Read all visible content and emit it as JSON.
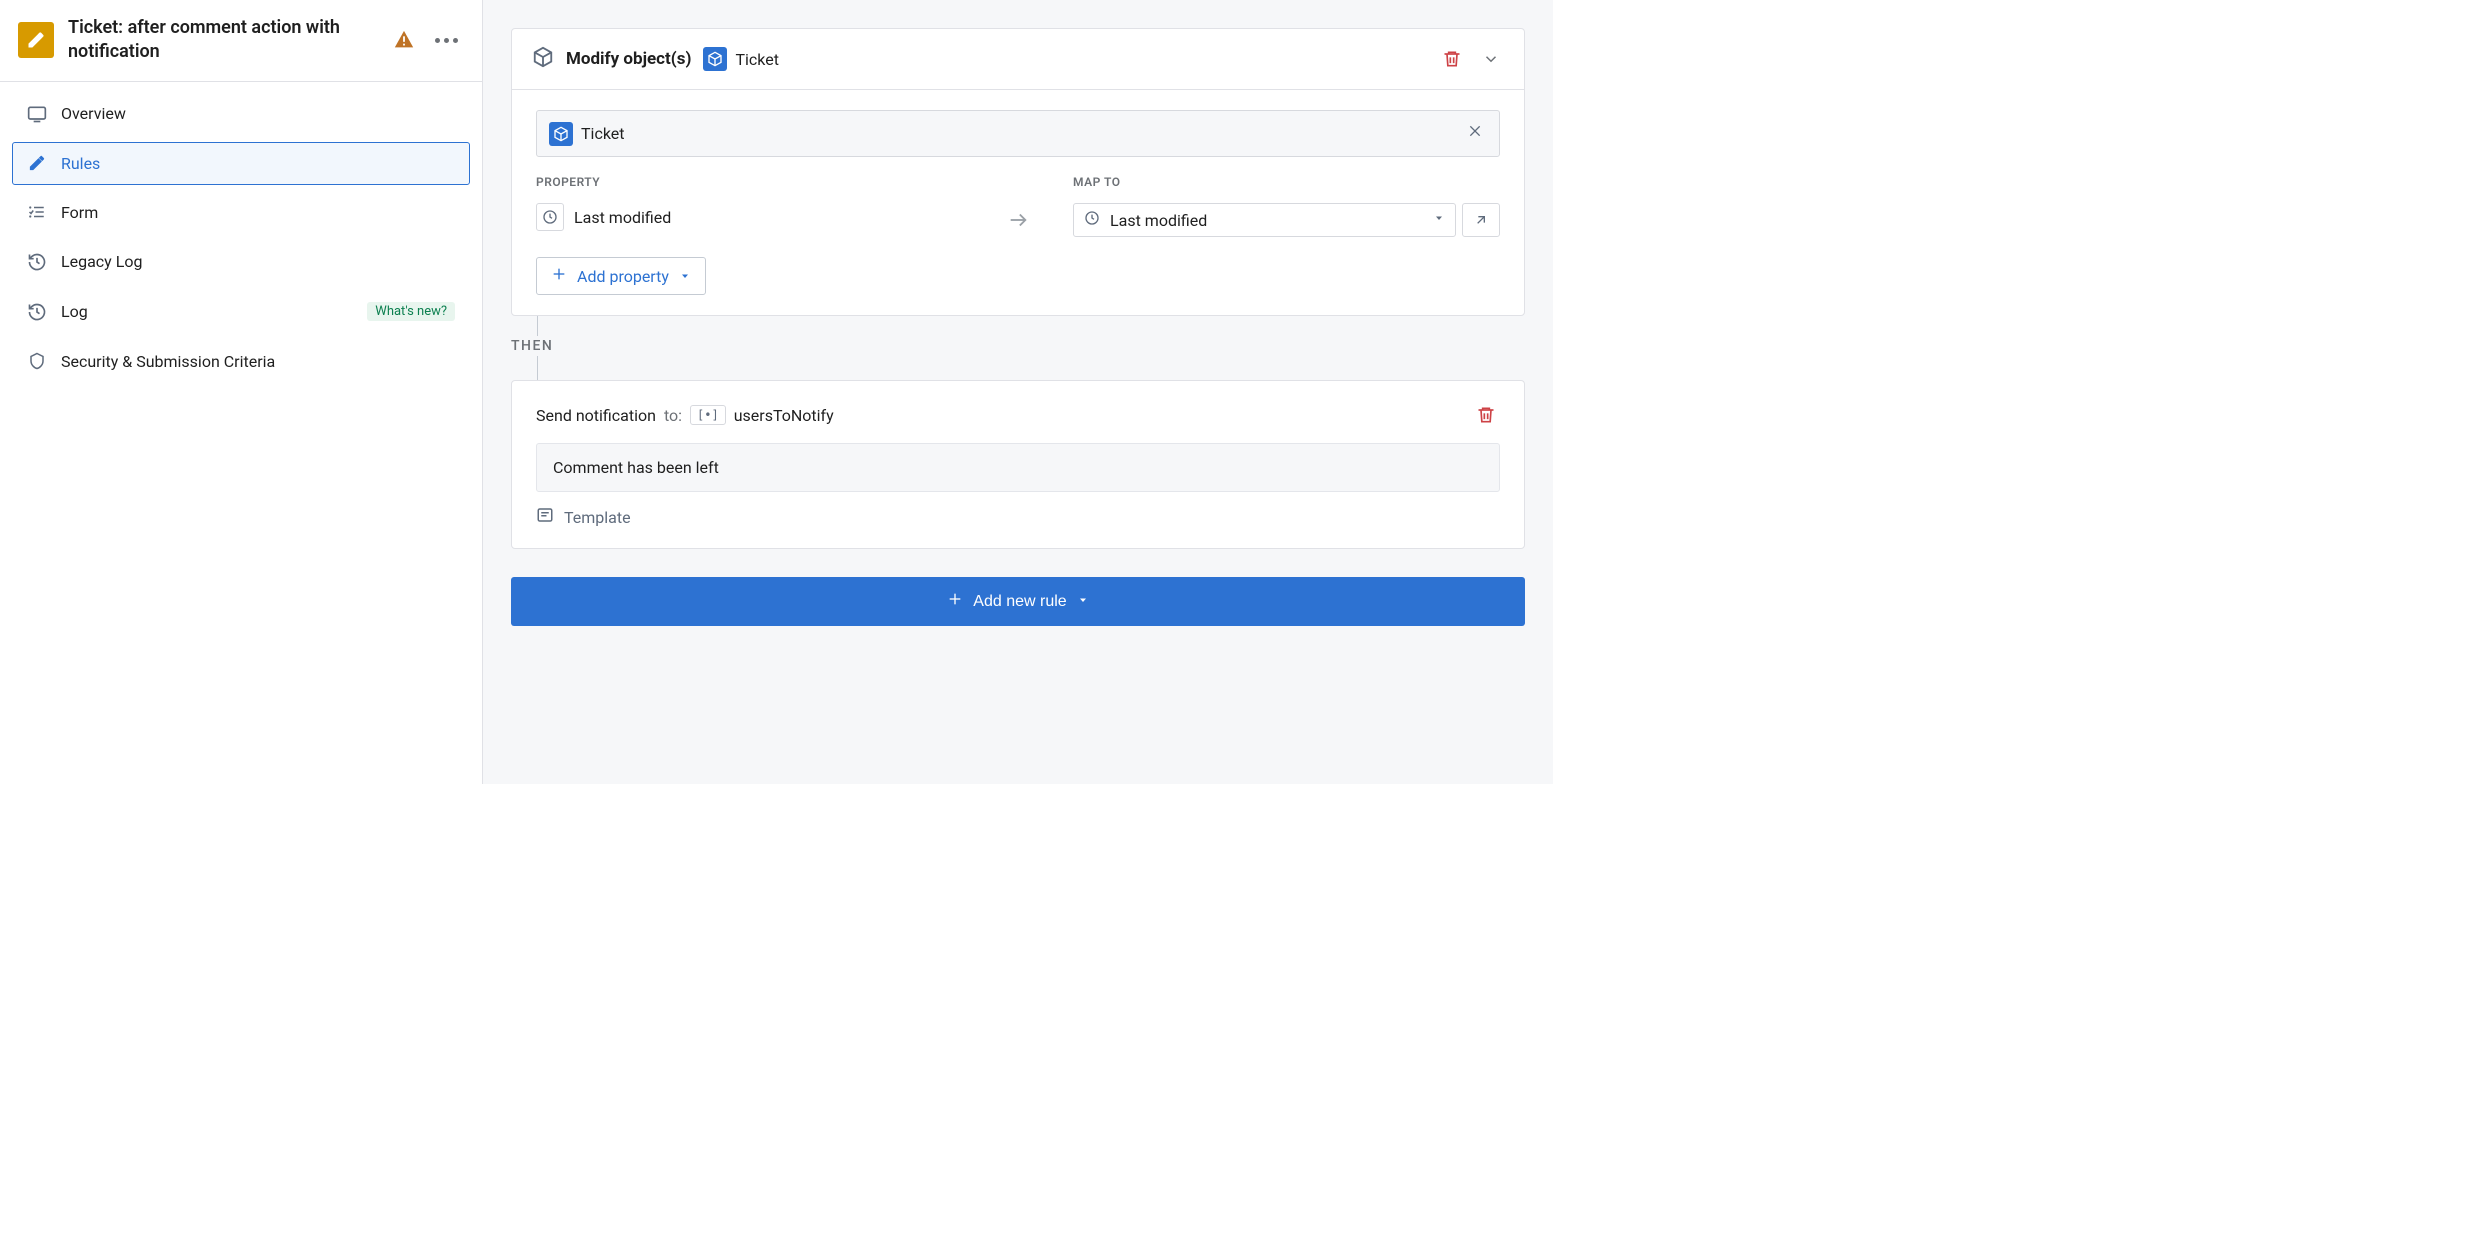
{
  "header": {
    "title": "Ticket: after comment action with notification"
  },
  "sidebar": {
    "items": [
      {
        "label": "Overview"
      },
      {
        "label": "Rules"
      },
      {
        "label": "Form"
      },
      {
        "label": "Legacy Log"
      },
      {
        "label": "Log",
        "badge": "What's new?"
      },
      {
        "label": "Security & Submission Criteria"
      }
    ]
  },
  "panel": {
    "title": "Modify object(s)",
    "object_label": "Ticket",
    "ticket_row_label": "Ticket",
    "property_header": "PROPERTY",
    "mapto_header": "MAP TO",
    "property_value": "Last modified",
    "mapto_value": "Last modified",
    "add_property_label": "Add property"
  },
  "then": {
    "label": "THEN",
    "send_label": "Send notification",
    "to_label": "to:",
    "recipient": "usersToNotify",
    "message": "Comment has been left",
    "template_label": "Template"
  },
  "add_rule_label": "Add new rule"
}
